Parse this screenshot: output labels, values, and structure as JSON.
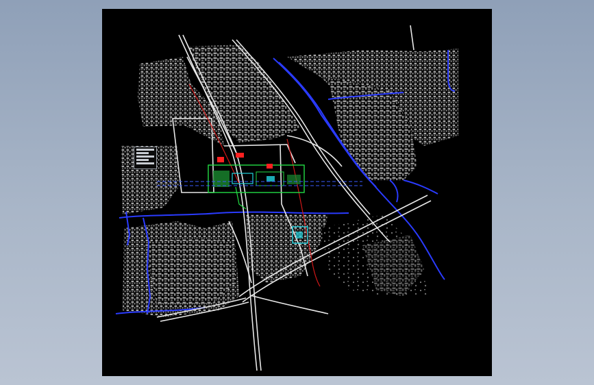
{
  "app": {
    "title": ""
  },
  "drawing": {
    "background": "#000000",
    "canvas_surround": "#9aa8bc",
    "colors": {
      "buildings": "#b5b5b5",
      "roads": "#e8e8e8",
      "water": "#2a3bff",
      "rail": "#d01818",
      "plaza_green": "#22dd44",
      "plaza_cyan": "#22d4e0",
      "highlight_red": "#ff2020"
    },
    "layers": [
      "building-blocks",
      "road-network",
      "waterways",
      "rail-corridor",
      "station-plaza",
      "legend-table"
    ]
  }
}
